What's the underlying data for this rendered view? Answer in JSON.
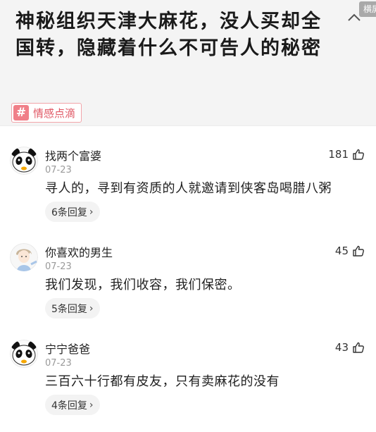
{
  "header": {
    "title": "神秘组织天津大麻花，没人买却全国转，隐藏着什么不可告人的秘密",
    "collapse_icon": "chevron-up-icon",
    "corner_badge": "横屏",
    "tag": {
      "icon": "hash-icon",
      "symbol": "#",
      "label": "情感点滴"
    }
  },
  "comments": [
    {
      "avatar": "panda-avatar",
      "username": "找两个富婆",
      "likes": "181",
      "date": "07-23",
      "text": "寻人的，寻到有资质的人就邀请到侠客岛喝腊八粥",
      "replies": "6条回复"
    },
    {
      "avatar": "anime-boy-avatar",
      "username": "你喜欢的男生",
      "likes": "45",
      "date": "07-23",
      "text": "我们发现，我们收容，我们保密。",
      "replies": "5条回复"
    },
    {
      "avatar": "panda-avatar",
      "username": "宁宁爸爸",
      "likes": "43",
      "date": "07-23",
      "text": "三百六十行都有皮友，只有卖麻花的没有",
      "replies": "4条回复"
    }
  ],
  "colors": {
    "accent": "#e05865",
    "tag_bg": "#f07f88",
    "header_bg": "#f4f4f4"
  }
}
